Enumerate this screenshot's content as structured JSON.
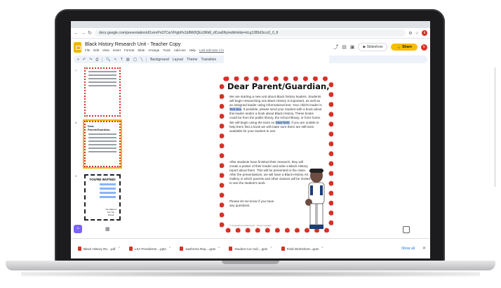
{
  "browser": {
    "url": "docs.google.com/presentation/d/1smrPn37CsrVFlgbHx1bBW0QEz3Rb8_dCoa6Ny/edit#slide=id.g1285d3ccc0_0_8",
    "profile_initial": "k"
  },
  "docs": {
    "title": "Black History Research Unit - Teacher Copy",
    "menus": [
      "File",
      "Edit",
      "View",
      "Insert",
      "Format",
      "Slide",
      "Arrange",
      "Tools",
      "Add-ons",
      "Help"
    ],
    "last_edit": "Last edit was 4 hours ago",
    "slideshow_label": "Slideshow",
    "share_label": "Share",
    "avatar_initial": "k",
    "toolbar_items": [
      "Background",
      "Layout",
      "Theme",
      "Transition"
    ]
  },
  "filmstrip": {
    "slide_numbers": [
      "7",
      "8",
      "9"
    ],
    "thumb_title": "Dear Parent/Guardian,",
    "invite_title": "YOU'RE INVITED!",
    "invite_note": "You Make It For You Friend"
  },
  "letter": {
    "greeting": "Dear Parent/Guardian,",
    "para1_a": "We are starting a new unit about Black history leaders. Students will begin researching one Black History is important, as well as an assigned leader using informational text. Your child's leader is",
    "para1_hl1": "Text box",
    "para1_b": ". If possible, please send your student with a book about this leader and/or a book about Black History. These books could be from the public library, the school library, or from home. We will begin using the texts on",
    "para1_hl2": "Date here",
    "para1_c": ". If you are unable to help them find a book we will make sure there are still texts available for your student to use.",
    "para2": "After students have finished their research, they will create a poster of their leader and write a Black History report about them. This will be presented to the class. After the presentations, we will have a Black History Art Gallery in which parents and other classes will be invited to see the student's work.",
    "para3": "Please let me know if you have any questions.",
    "footer": "© Copyright Amanda Doyle · Kinder Nuggets"
  },
  "downloads": {
    "items": [
      "Black History Re....pdf",
      "LSA Presidents ...pptx",
      "Jawforms Rep....pptx",
      "Student Cur Indi....pptx",
      "Field Worksheet...pptx"
    ],
    "show_all": "Show all"
  }
}
